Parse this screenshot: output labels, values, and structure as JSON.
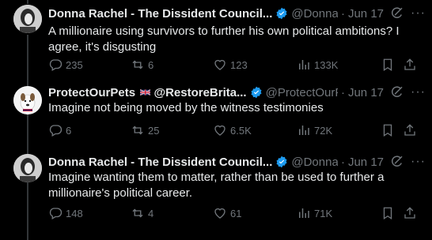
{
  "tweets": [
    {
      "name": "Donna Rachel - The Dissident Council...",
      "handle": "@Donna_Rac...",
      "date": "Jun 17",
      "text": "A millionaire using survivors to further his own political ambitions? I agree, it's disgusting",
      "replies": "235",
      "retweets": "6",
      "likes": "123",
      "views": "133K"
    },
    {
      "name": "ProtectOurPets",
      "name2": "@RestoreBrita...",
      "handle": "@ProtectOurPet...",
      "date": "Jun 17",
      "text": "Imagine not being moved by the witness testimonies",
      "replies": "6",
      "retweets": "25",
      "likes": "6.5K",
      "views": "72K"
    },
    {
      "name": "Donna Rachel - The Dissident Council...",
      "handle": "@Donna_Rac...",
      "date": "Jun 17",
      "text": "Imagine wanting them to matter, rather than be used to further a millionaire's political career.",
      "replies": "148",
      "retweets": "4",
      "likes": "61",
      "views": "71K"
    }
  ],
  "icons": {
    "verified": "verified-badge-icon",
    "grok": "grok-icon",
    "more": "more-icon",
    "reply": "reply-icon",
    "retweet": "retweet-icon",
    "like": "heart-icon",
    "views": "views-icon",
    "bookmark": "bookmark-icon",
    "share": "share-icon"
  },
  "colors": {
    "background": "#000000",
    "text": "#e7e9ea",
    "secondary": "#71767b",
    "verified": "#1d9bf0"
  }
}
